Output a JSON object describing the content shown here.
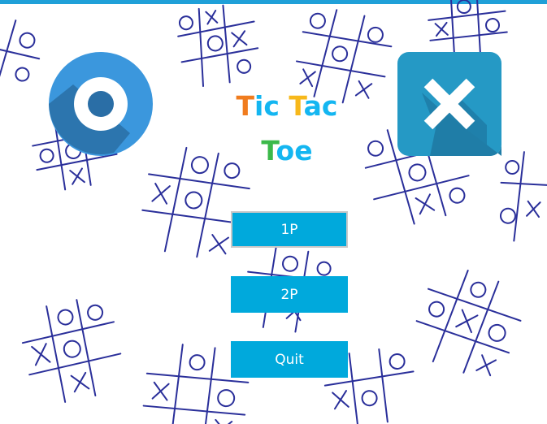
{
  "title": {
    "line1_parts": [
      {
        "text": "T",
        "color": "#f07c1e"
      },
      {
        "text": "ic ",
        "color": "#14b6f1"
      },
      {
        "text": "T",
        "color": "#f7b81b"
      },
      {
        "text": "ac",
        "color": "#14b6f1"
      }
    ],
    "line2_parts": [
      {
        "text": "T",
        "color": "#3cb94a"
      },
      {
        "text": "oe",
        "color": "#14b6f1"
      }
    ]
  },
  "menu": {
    "one_player_label": "1P",
    "two_player_label": "2P",
    "quit_label": "Quit"
  },
  "colors": {
    "accent": "#00a9dc",
    "o_circle_light": "#3b97dd",
    "o_circle_dark": "#2a6ea6",
    "x_tile_light": "#2599c5",
    "x_tile_dark": "#1f7da7",
    "doodle_ink": "#2a2f9a"
  },
  "icons": [
    "o-logo-icon",
    "x-logo-icon"
  ]
}
